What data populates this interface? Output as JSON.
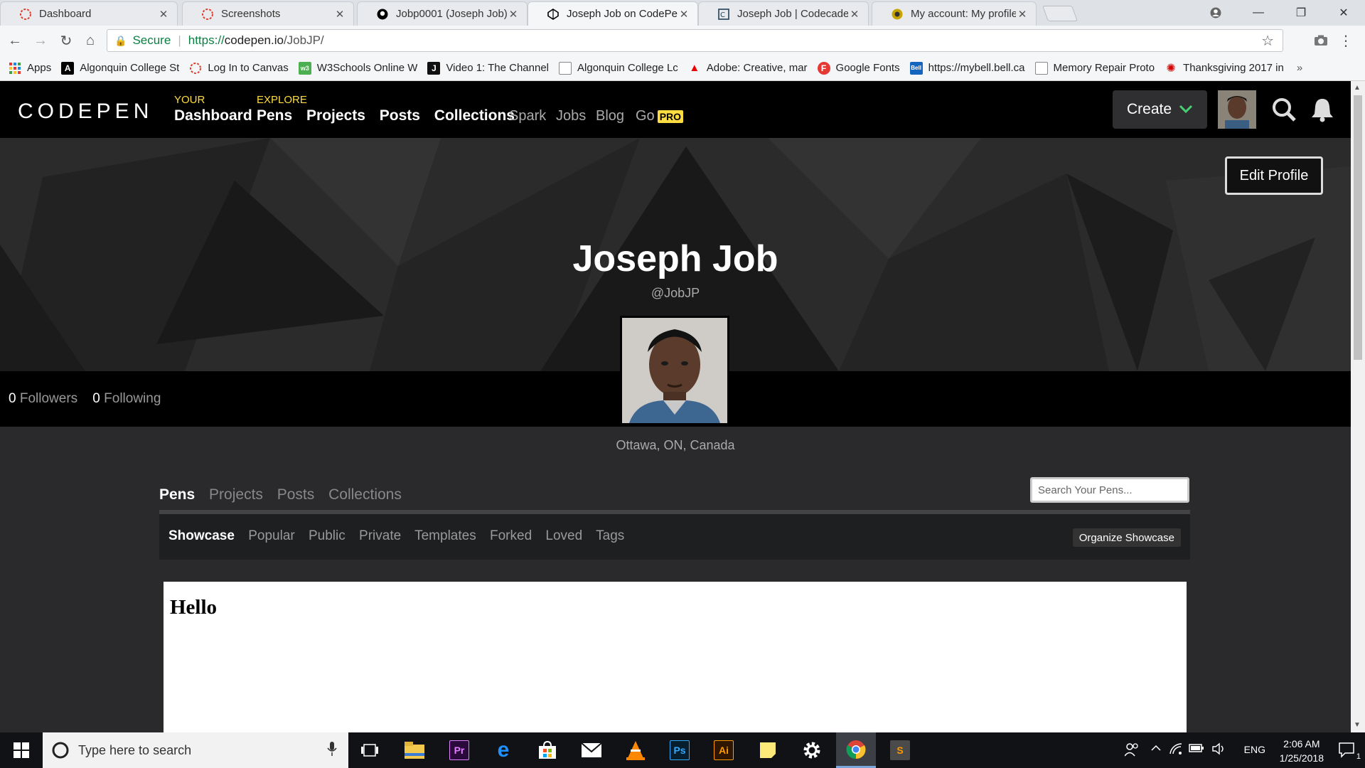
{
  "browser": {
    "tabs": [
      {
        "title": "Dashboard",
        "icon": "canvas-icon",
        "color": "#e03e2d"
      },
      {
        "title": "Screenshots",
        "icon": "canvas-icon",
        "color": "#e03e2d"
      },
      {
        "title": "Jobp0001 (Joseph Job)",
        "icon": "github-icon",
        "color": "#000000"
      },
      {
        "title": "Joseph Job on CodePen",
        "icon": "codepen-icon",
        "color": "#000000"
      },
      {
        "title": "Joseph Job | Codecadem",
        "icon": "codecademy-icon",
        "color": "#1f4056"
      },
      {
        "title": "My account: My profile |",
        "icon": "account-icon",
        "color": "#c8a400"
      }
    ],
    "address": {
      "secure_label": "Secure",
      "url_scheme": "https://",
      "url_host": "codepen.io",
      "url_path": "/JobJP/"
    },
    "bookmarks": [
      {
        "label": "Apps",
        "color": "#d44"
      },
      {
        "label": "Algonquin College St",
        "color": "#000"
      },
      {
        "label": "Log In to Canvas",
        "color": "#e03e2d"
      },
      {
        "label": "W3Schools Online W",
        "color": "#4caf50"
      },
      {
        "label": "Video 1: The Channel",
        "color": "#111"
      },
      {
        "label": "Algonquin College Lc",
        "color": "#888"
      },
      {
        "label": "Adobe: Creative, mar",
        "color": "#e00"
      },
      {
        "label": "Google Fonts",
        "color": "#e53935"
      },
      {
        "label": "https://mybell.bell.ca",
        "color": "#1565c0"
      },
      {
        "label": "Memory Repair Proto",
        "color": "#888"
      },
      {
        "label": "Thanksgiving 2017 in",
        "color": "#d50000"
      }
    ]
  },
  "codepen": {
    "logo": "CODEPEN",
    "nav": {
      "your_label": "YOUR",
      "dashboard": "Dashboard",
      "explore_label": "EXPLORE",
      "pens": "Pens",
      "projects": "Projects",
      "posts": "Posts",
      "collections": "Collections",
      "spark": "Spark",
      "jobs": "Jobs",
      "blog": "Blog",
      "go": "Go",
      "pro": "PRO"
    },
    "create_label": "Create",
    "accent_color": "#47cf73",
    "pro_color": "#ffdd40"
  },
  "profile": {
    "edit_label": "Edit Profile",
    "name": "Joseph Job",
    "handle": "@JobJP",
    "followers_count": "0",
    "followers_label": "Followers",
    "following_count": "0",
    "following_label": "Following",
    "location": "Ottawa, ON, Canada"
  },
  "pens_section": {
    "tabs": [
      "Pens",
      "Projects",
      "Posts",
      "Collections"
    ],
    "active_tab": "Pens",
    "search_placeholder": "Search Your Pens...",
    "subtabs": [
      "Showcase",
      "Popular",
      "Public",
      "Private",
      "Templates",
      "Forked",
      "Loved",
      "Tags"
    ],
    "active_subtab": "Showcase",
    "organize_label": "Organize Showcase",
    "pen_preview_heading": "Hello"
  },
  "taskbar": {
    "search_placeholder": "Type here to search",
    "language": "ENG",
    "time": "2:06 AM",
    "date": "1/25/2018",
    "notification_count": "1",
    "apps": [
      {
        "name": "task-view-icon",
        "label": ""
      },
      {
        "name": "file-explorer-icon",
        "label": ""
      },
      {
        "name": "premiere-icon",
        "label": "Pr"
      },
      {
        "name": "edge-icon",
        "label": "e"
      },
      {
        "name": "store-icon",
        "label": ""
      },
      {
        "name": "mail-icon",
        "label": ""
      },
      {
        "name": "vlc-icon",
        "label": ""
      },
      {
        "name": "photoshop-icon",
        "label": "Ps"
      },
      {
        "name": "illustrator-icon",
        "label": "Ai"
      },
      {
        "name": "sticky-notes-icon",
        "label": ""
      },
      {
        "name": "settings-icon",
        "label": ""
      },
      {
        "name": "chrome-icon",
        "label": ""
      },
      {
        "name": "sublime-icon",
        "label": "S"
      }
    ]
  }
}
